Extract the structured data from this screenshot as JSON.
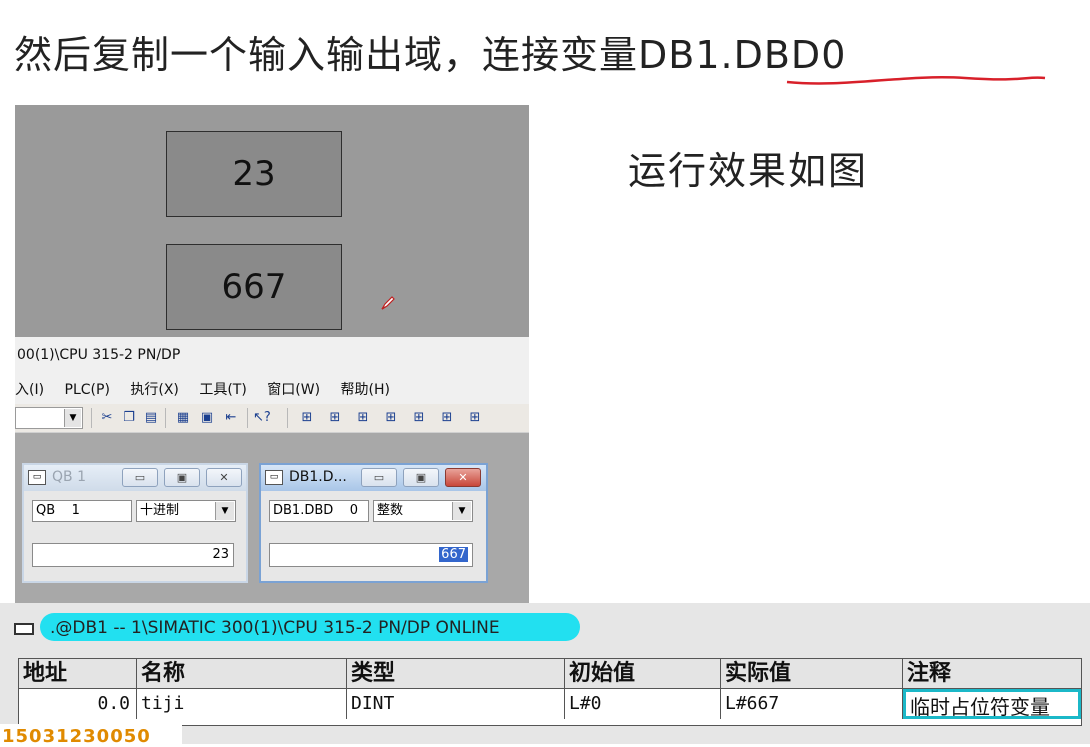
{
  "title": {
    "prefix": "然后复制一个输入输出域，连接变量",
    "code": "DB1.DBD0"
  },
  "caption": "运行效果如图",
  "hmi": {
    "field1_value": "23",
    "field2_value": "667"
  },
  "step7": {
    "path": "00(1)\\CPU 315-2 PN/DP",
    "menu": [
      "入(I)",
      "PLC(P)",
      "执行(X)",
      "工具(T)",
      "窗口(W)",
      "帮助(H)"
    ],
    "toolbar_icons": [
      "cut-icon",
      "copy-icon",
      "paste-icon",
      "monitor-icon",
      "grid-icon",
      "force-icon",
      "help-cursor-icon",
      "var-icon-1",
      "var-icon-2",
      "var-icon-3",
      "var-icon-4",
      "var-icon-5",
      "var-icon-6",
      "var-icon-7"
    ],
    "win_qb": {
      "title": "QB   1",
      "address": "QB    1",
      "format": "十进制",
      "value": "23"
    },
    "win_db": {
      "title": "DB1.D...",
      "address": "DB1.DBD    0",
      "format": "整数",
      "value": "667"
    }
  },
  "var_table": {
    "title": ".@DB1 -- 1\\SIMATIC 300(1)\\CPU 315-2 PN/DP  ONLINE",
    "columns": [
      "地址",
      "名称",
      "类型",
      "初始值",
      "实际值",
      "注释"
    ],
    "row": {
      "address": "0.0",
      "name": "tiji",
      "type": "DINT",
      "initial": "L#0",
      "actual": "L#667",
      "comment": "临时占位符变量"
    }
  },
  "watermark": "15031230050",
  "colors": {
    "hmi_bg": "#9a9a9a",
    "title_highlight": "#22e0f0",
    "underline": "#d8202a"
  }
}
